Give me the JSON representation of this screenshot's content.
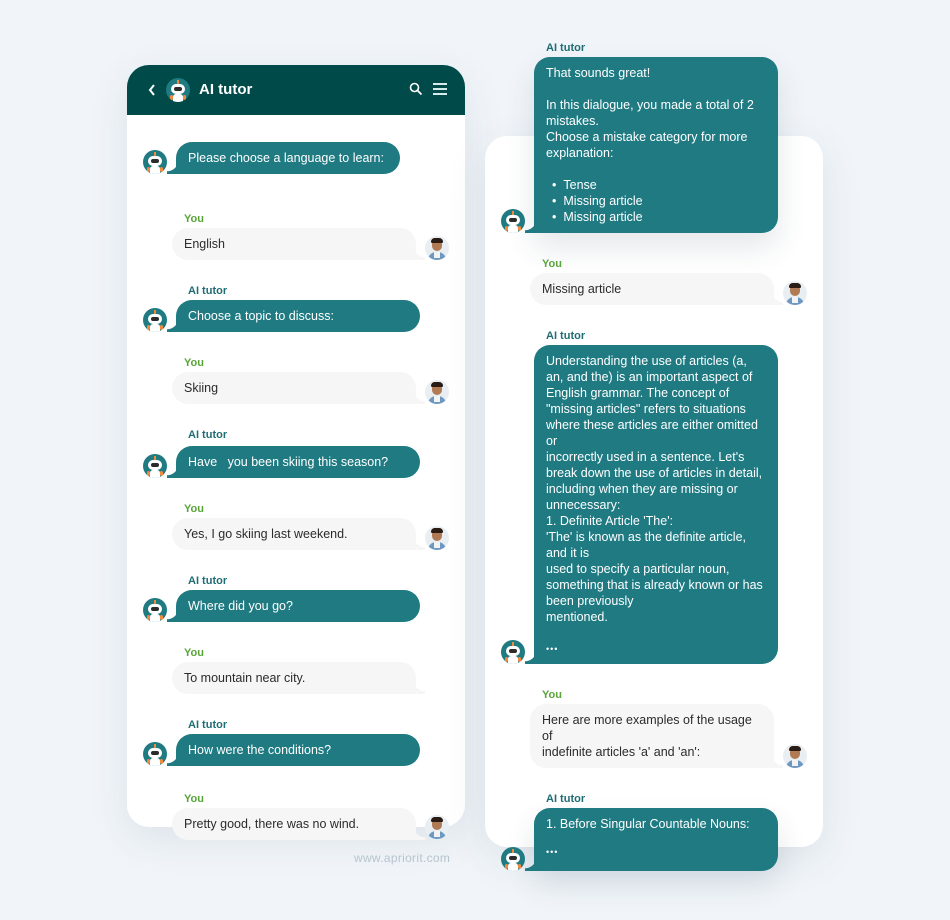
{
  "header": {
    "title": "AI tutor",
    "back_icon": "chevron-left-icon",
    "search_icon": "search-icon",
    "menu_icon": "hamburger-menu-icon"
  },
  "labels": {
    "you": "You",
    "ai": "AI tutor"
  },
  "colors": {
    "header_bg": "#004b49",
    "ai_bubble": "#1f7a82",
    "user_bubble": "#f6f6f6",
    "you_label": "#5aa53a",
    "ai_label": "#1f6d75",
    "page_bg": "#f1f5f9"
  },
  "left_chat": {
    "messages": [
      {
        "sender": "ai",
        "text": "Please choose a language to learn:",
        "show_label": false
      },
      {
        "sender": "you",
        "text": "English"
      },
      {
        "sender": "ai",
        "text": "Choose a topic to discuss:"
      },
      {
        "sender": "you",
        "text": "Skiing"
      },
      {
        "sender": "ai",
        "text": "Have   you been skiing this season?"
      },
      {
        "sender": "you",
        "text": "Yes, I go skiing last weekend."
      },
      {
        "sender": "ai",
        "text": "Where did you go?"
      },
      {
        "sender": "you",
        "text": "To mountain near city.",
        "avatar": false
      },
      {
        "sender": "ai",
        "text": "How were the conditions?"
      },
      {
        "sender": "you",
        "text": "Pretty good, there was no wind."
      }
    ]
  },
  "right_chat": {
    "messages": [
      {
        "sender": "ai",
        "intro": "That sounds great!",
        "body": "In this dialogue, you made a total of 2 mistakes.\nChoose a mistake category for more explanation:",
        "options": [
          "Tense",
          "Missing article",
          "Missing article"
        ]
      },
      {
        "sender": "you",
        "text": "Missing article"
      },
      {
        "sender": "ai",
        "text": "Understanding the use of articles (a, an, and the) is an important aspect of English grammar. The concept of \"missing articles\" refers to situations where these articles are either omitted or\nincorrectly used in a sentence. Let's break down the use of articles in detail, including when they are missing or unnecessary:\n1. Definite Article 'The':\n'The' is known as the definite article, and it is\nused to specify a particular noun, something that is already known or has been previously\nmentioned.",
        "more": "•••"
      },
      {
        "sender": "you",
        "text": "Here are more examples of the usage of\nindefinite articles 'a' and 'an':"
      },
      {
        "sender": "ai",
        "text": "1. Before Singular Countable Nouns:",
        "more": "•••"
      }
    ]
  },
  "watermark": "www.apriorit.com"
}
